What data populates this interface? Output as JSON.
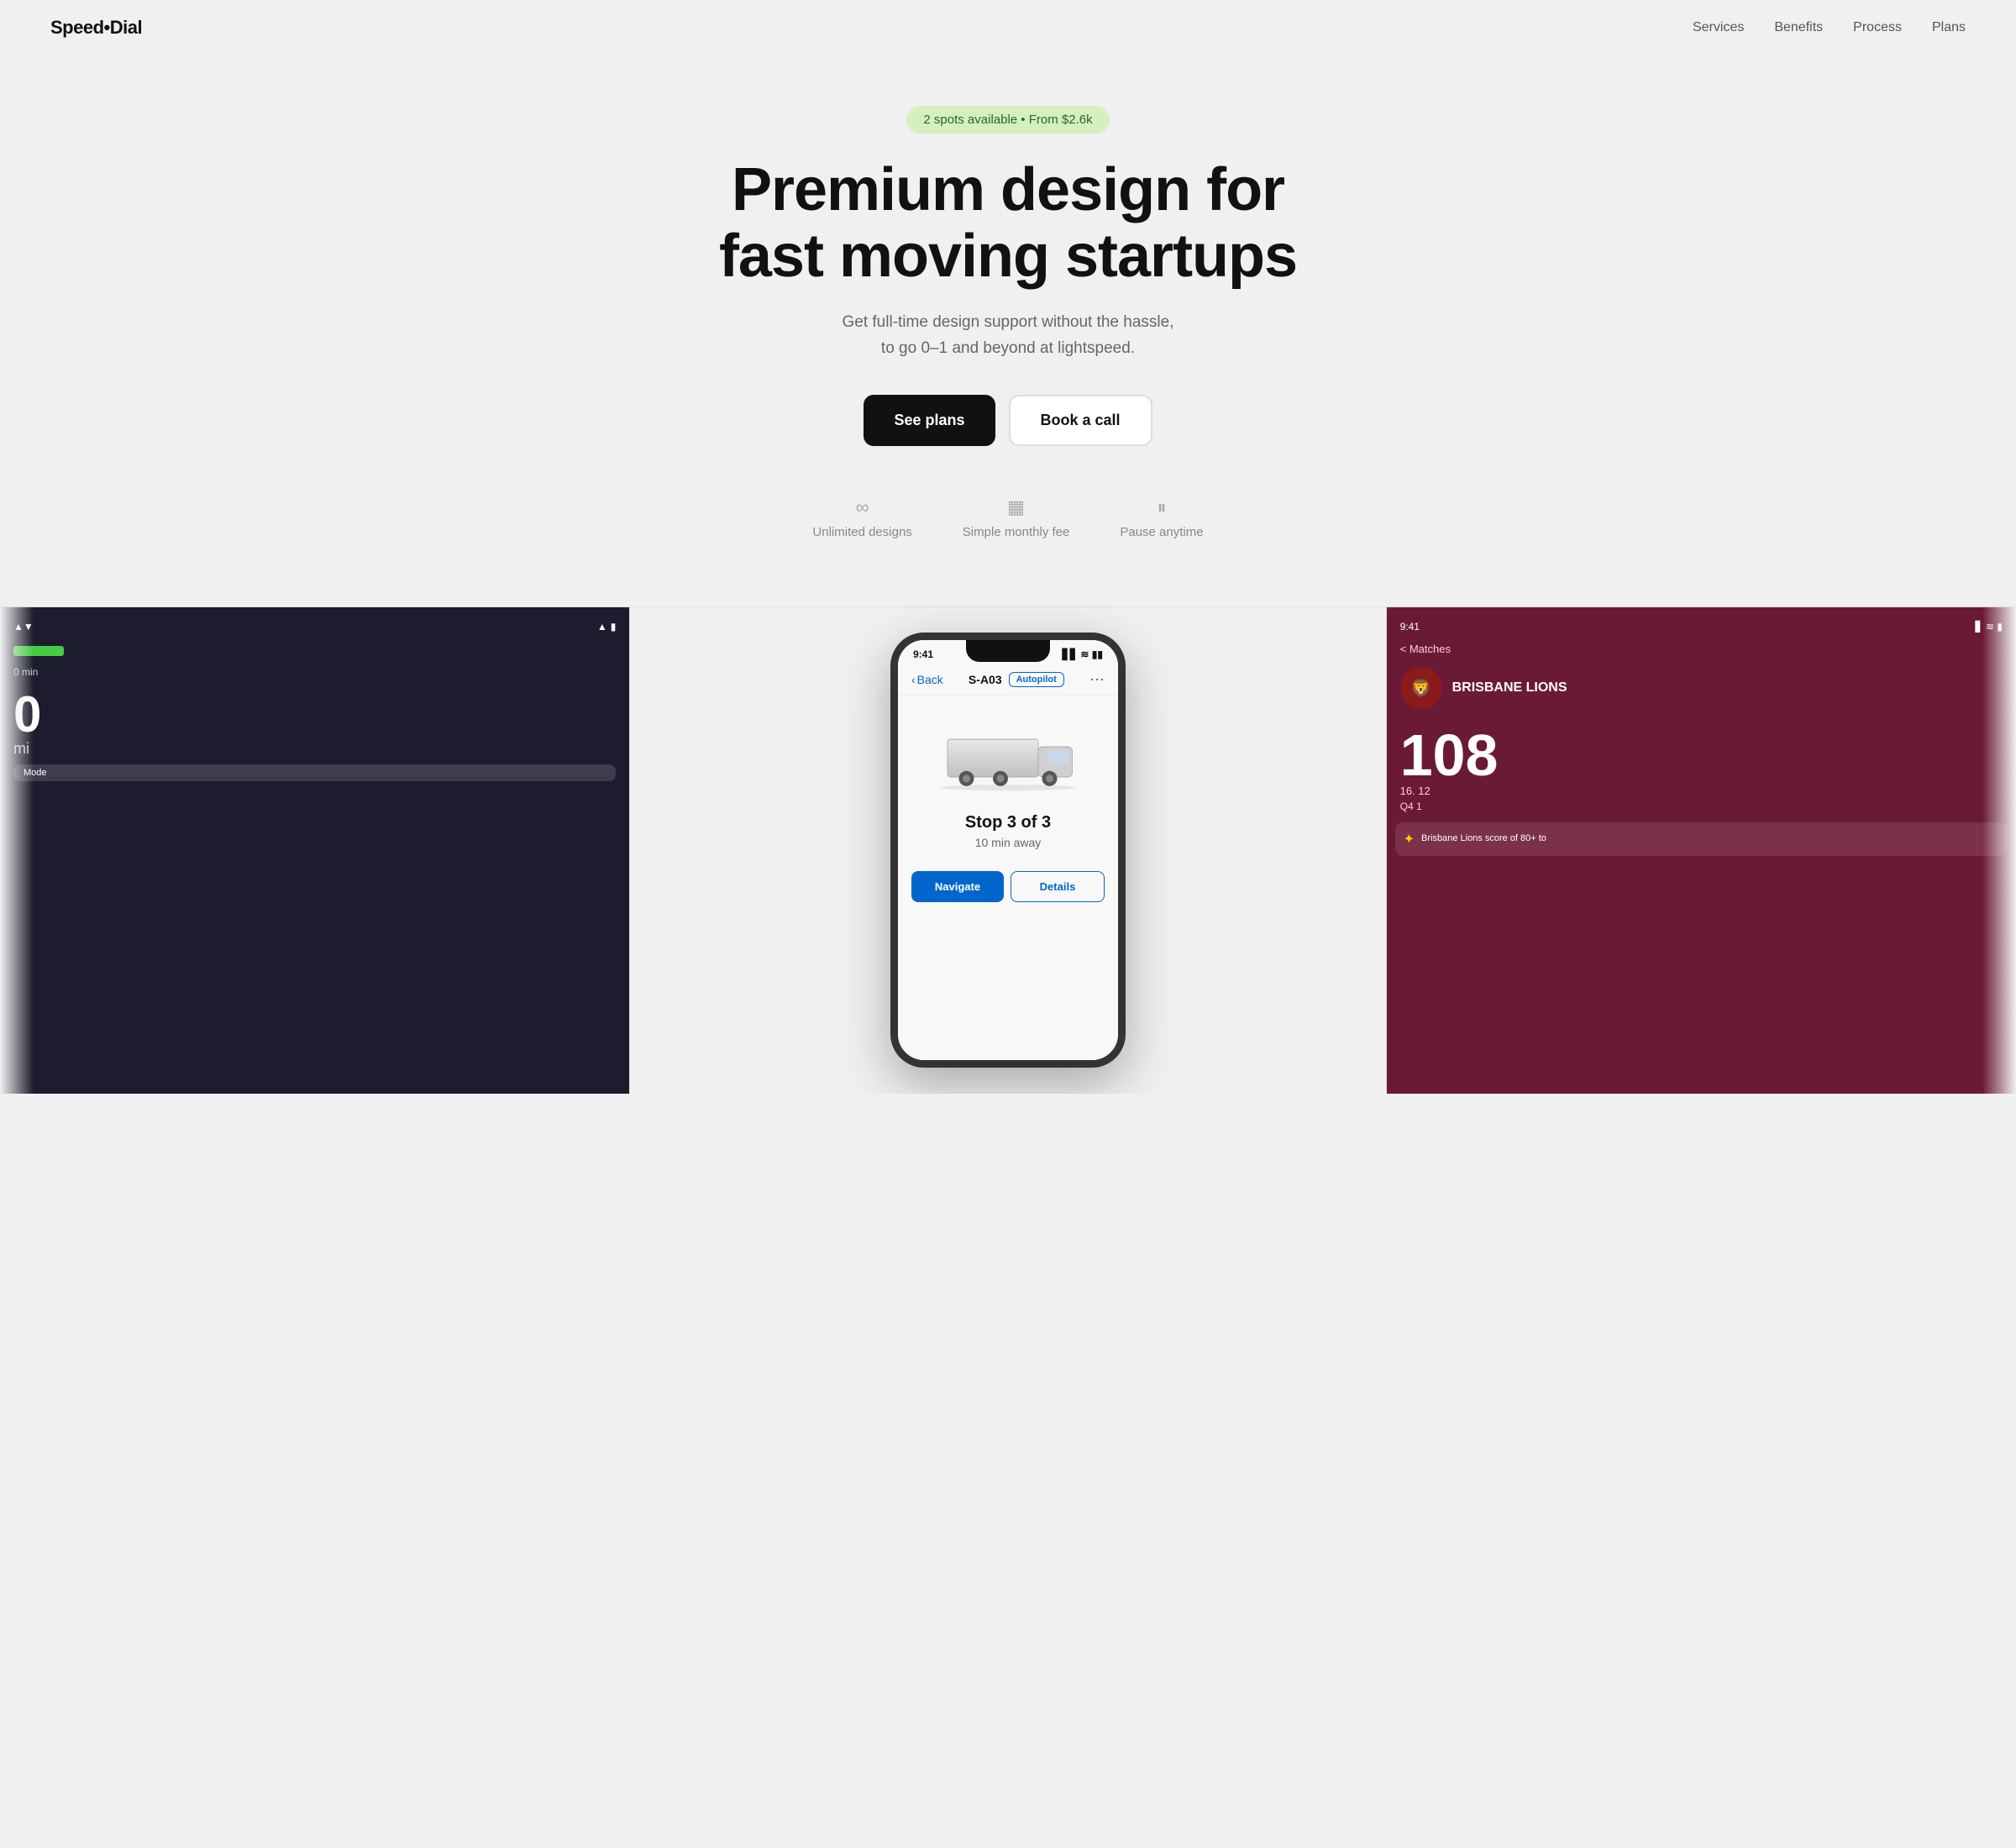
{
  "brand": {
    "logo": "Speed•Dial"
  },
  "nav": {
    "links": [
      {
        "label": "Services",
        "href": "#services"
      },
      {
        "label": "Benefits",
        "href": "#benefits"
      },
      {
        "label": "Process",
        "href": "#process"
      },
      {
        "label": "Plans",
        "href": "#plans"
      }
    ]
  },
  "hero": {
    "badge": "2 spots available • From $2.6k",
    "title_line1": "Premium design for",
    "title_line2": "fast moving startups",
    "subtitle_line1": "Get full-time design support without the hassle,",
    "subtitle_line2": "to go 0–1 and beyond at lightspeed.",
    "btn_plans": "See plans",
    "btn_call": "Book a call",
    "features": [
      {
        "icon": "∞",
        "label": "Unlimited designs"
      },
      {
        "icon": "▦",
        "label": "Simple monthly fee"
      },
      {
        "icon": "⏸",
        "label": "Pause anytime"
      }
    ]
  },
  "phone_left": {
    "time": "",
    "distance": "0",
    "distance_unit": "mi",
    "time_remaining": "0 min",
    "mode": "Mode"
  },
  "phone_center": {
    "status_time": "9:41",
    "back_label": "Back",
    "ticket_id": "S-A03",
    "autopilot": "Autopilot",
    "stop_text": "Stop 3 of 3",
    "time_away": "10 min away",
    "btn1": "Navigate",
    "btn2": "Details"
  },
  "phone_right": {
    "status_time": "9:41",
    "back_label": "< Matches",
    "team": "BRISBANE LIONS",
    "score": "108",
    "score_sub": "16. 12",
    "quarter": "Q4 1",
    "news_text": "Brisbane Lions score of 80+ to"
  }
}
